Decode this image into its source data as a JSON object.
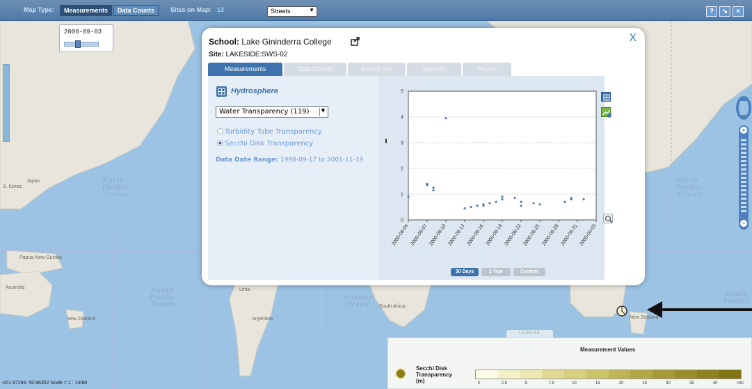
{
  "topbar": {
    "map_type_label": "Map Type:",
    "measurements_label": "Measurements",
    "data_counts_label": "Data Counts",
    "sites_on_map_label": "Sites on Map:",
    "sites_on_map_count": "13",
    "basemap_value": "Streets",
    "help_label": "?",
    "tool_label": "↘",
    "close_label": "×"
  },
  "date_slider": {
    "date": "2000-09-03",
    "position": 0.35
  },
  "map_labels": {
    "north_pacific_left": [
      "North",
      "Pacific",
      "Ocean"
    ],
    "north_pacific_right": [
      "North",
      "Pacific",
      "Ocean"
    ],
    "south_pacific_left": [
      "South",
      "Pacific",
      "Ocean"
    ],
    "south_pacific_right": [
      "South",
      "Pacific"
    ],
    "atlantic": [
      "Atlantic",
      "Ocean"
    ],
    "japan": "Japan",
    "korea": "S. Korea",
    "papua": "Papua New Guinea",
    "australia": "Australia",
    "new_zealand_left": "New Zealand",
    "new_zealand_right": "New Zealand",
    "argentina": "Argentina",
    "south_africa": "South Africa",
    "lima": "Lima"
  },
  "dialog": {
    "school_label": "School:",
    "school_name": "Lake Gininderra College",
    "site_label": "Site:",
    "site_value": "LAKESIDE:SWS-02",
    "close_label": "X",
    "tabs": [
      "Measurements",
      "Data Counts",
      "School Info",
      "Site Info",
      "Photos"
    ],
    "sphere_title": "Hydrosphere",
    "measure_select": "Water Transparency (119)",
    "radio_options": [
      {
        "label": "Turbidity Tube Transparency",
        "selected": false
      },
      {
        "label": "Secchi Disk Transparency",
        "selected": true
      }
    ],
    "data_range_label": "Data Date Range:",
    "data_range_value": "1998-09-17 to 2001-11-19",
    "range_buttons": [
      "30 Days",
      "1 Year",
      "Custom"
    ]
  },
  "chart_data": {
    "type": "scatter",
    "x_ticks": [
      "2000-08-04",
      "2000-08-07",
      "2000-08-10",
      "2000-08-13",
      "2000-08-16",
      "2000-08-19",
      "2000-08-22",
      "2000-08-25",
      "2000-08-28",
      "2000-08-31",
      "2000-09-03"
    ],
    "ylim": [
      0,
      5
    ],
    "y_ticks": [
      "0",
      "1",
      "2",
      "3",
      "4",
      "5"
    ],
    "grid": true,
    "points": [
      [
        "2000-08-04",
        0.9
      ],
      [
        "2000-08-07",
        1.4
      ],
      [
        "2000-08-07",
        1.35
      ],
      [
        "2000-08-08",
        1.25
      ],
      [
        "2000-08-08",
        1.15
      ],
      [
        "2000-08-10",
        3.95
      ],
      [
        "2000-08-13",
        0.45
      ],
      [
        "2000-08-14",
        0.5
      ],
      [
        "2000-08-15",
        0.55
      ],
      [
        "2000-08-16",
        0.55
      ],
      [
        "2000-08-16",
        0.6
      ],
      [
        "2000-08-17",
        0.65
      ],
      [
        "2000-08-18",
        0.7
      ],
      [
        "2000-08-19",
        0.8
      ],
      [
        "2000-08-19",
        0.9
      ],
      [
        "2000-08-21",
        0.85
      ],
      [
        "2000-08-22",
        0.7
      ],
      [
        "2000-08-22",
        0.55
      ],
      [
        "2000-08-24",
        0.65
      ],
      [
        "2000-08-25",
        0.6
      ],
      [
        "2000-08-29",
        0.7
      ],
      [
        "2000-08-30",
        0.8
      ],
      [
        "2000-08-30",
        0.85
      ],
      [
        "2000-09-01",
        0.8
      ]
    ]
  },
  "legend": {
    "tab_label": "LEGEND",
    "title": "Measurement Values",
    "measure_name": [
      "Secchi Disk",
      "Transparency",
      "(m)"
    ],
    "ramp_colors": [
      "#fbfbe6",
      "#f3f1c8",
      "#ece8b2",
      "#e0da94",
      "#d6cf7e",
      "#cbc36a",
      "#bfb557",
      "#b3a746",
      "#a89a38",
      "#9c8d2c",
      "#8f8020",
      "#827315"
    ],
    "ramp_labels": [
      "0",
      "2.5",
      "5",
      "7.5",
      "10",
      "15",
      "20",
      "25",
      "30",
      "35",
      "40",
      ">40"
    ]
  },
  "scale_text": "-201.97266, 50.96352 Scale = 1 : 140M"
}
